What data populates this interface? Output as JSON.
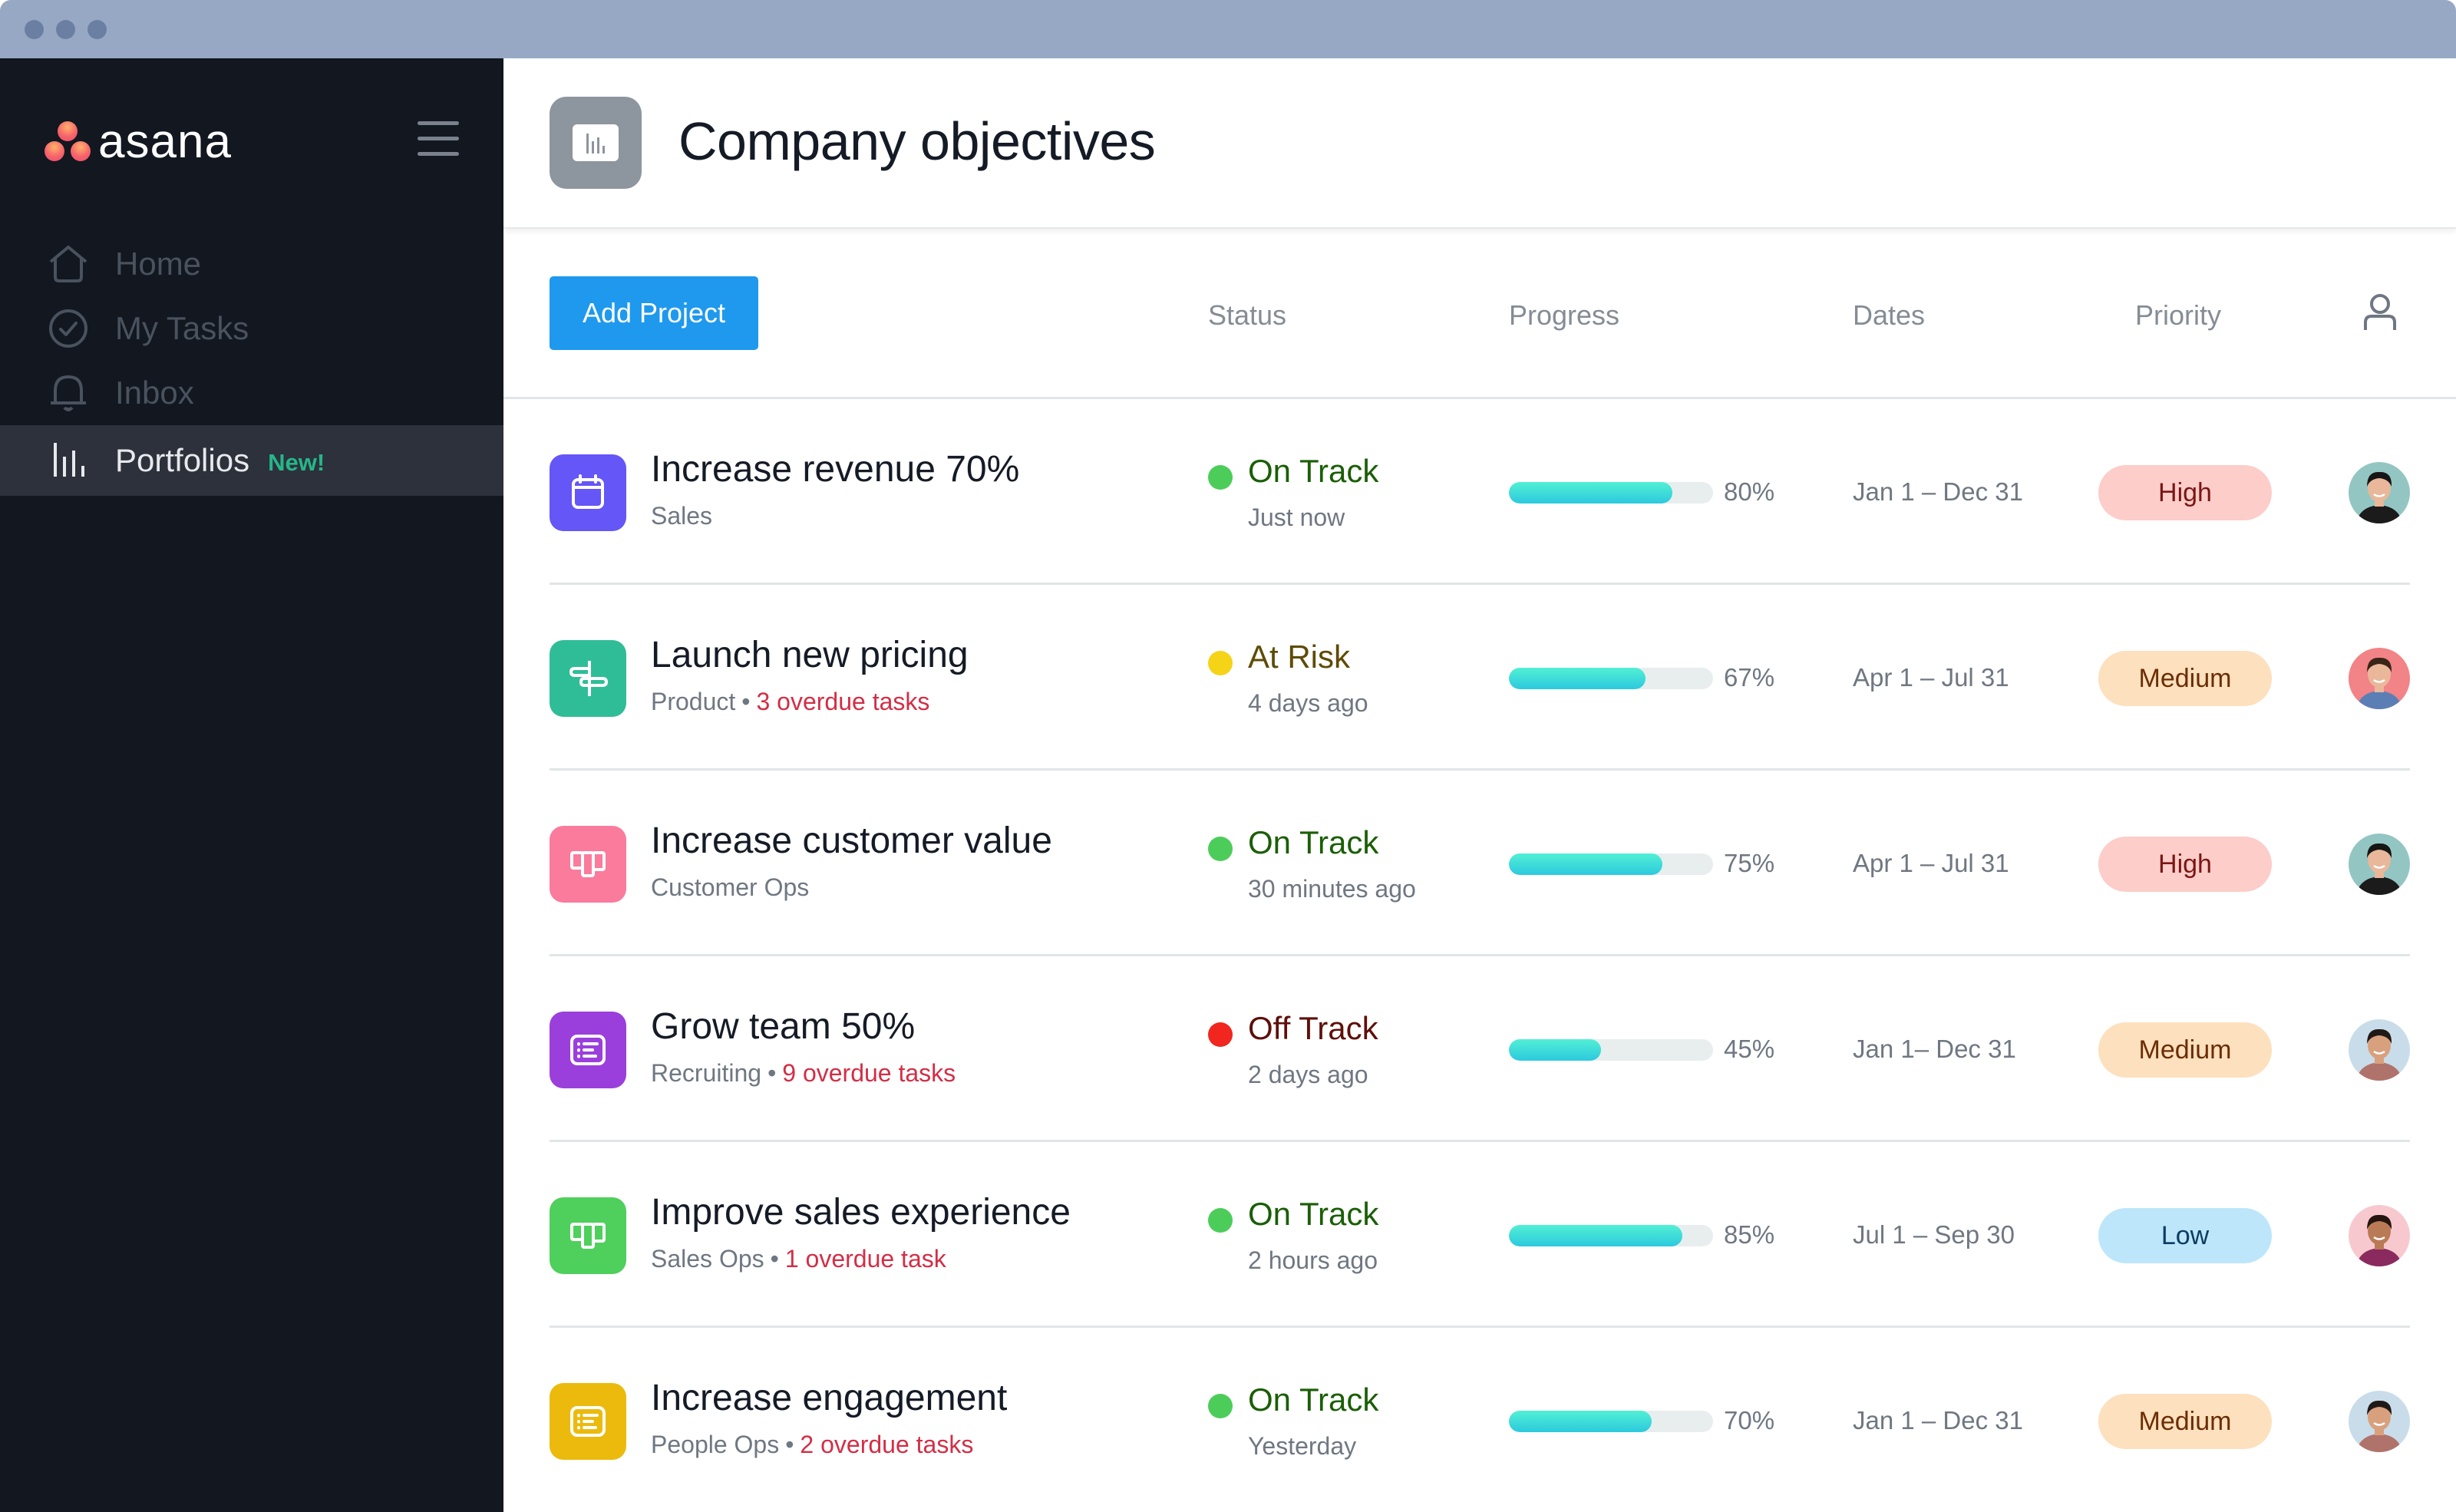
{
  "window": {
    "traffic_lights": [
      "close",
      "minimize",
      "maximize"
    ]
  },
  "sidebar": {
    "logo_text": "asana",
    "menu_icon": "hamburger-menu-icon",
    "items": [
      {
        "label": "Home",
        "icon": "home-icon",
        "active": false,
        "badge": null
      },
      {
        "label": "My Tasks",
        "icon": "check-circle-icon",
        "active": false,
        "badge": null
      },
      {
        "label": "Inbox",
        "icon": "bell-icon",
        "active": false,
        "badge": null
      },
      {
        "label": "Portfolios",
        "icon": "bar-chart-icon",
        "active": true,
        "badge": "New!"
      }
    ]
  },
  "header": {
    "icon": "portfolio-chart-icon",
    "title": "Company objectives"
  },
  "toolbar": {
    "add_project_label": "Add Project",
    "columns": [
      "Status",
      "Progress",
      "Dates",
      "Priority"
    ],
    "owner_icon": "person-icon"
  },
  "colors": {
    "accent": "#1e99ee",
    "on_track": "#4ccd5a",
    "at_risk": "#f5d317",
    "off_track": "#f0261f",
    "overdue": "#d32e46",
    "progress_fill": "#36d6db"
  },
  "projects": [
    {
      "name": "Increase revenue 70%",
      "team": "Sales",
      "overdue": null,
      "icon": "calendar-icon",
      "icon_color": "#6456f7",
      "status": "On Track",
      "status_color": "#4ccd5a",
      "status_text_color": "#1b5e06",
      "updated": "Just now",
      "progress": 80,
      "progress_label": "80%",
      "dates": "Jan 1 – Dec 31",
      "priority": "High",
      "priority_bg": "#fccdc9",
      "priority_fg": "#7a1614",
      "avatar": "avatar-woman-teal"
    },
    {
      "name": "Launch new pricing",
      "team": "Product",
      "overdue": "3 overdue tasks",
      "icon": "signpost-icon",
      "icon_color": "#2fbd98",
      "status": "At Risk",
      "status_color": "#f5d317",
      "status_text_color": "#5e4b05",
      "updated": "4 days ago",
      "progress": 67,
      "progress_label": "67%",
      "dates": "Apr 1 – Jul 31",
      "priority": "Medium",
      "priority_bg": "#fde0bd",
      "priority_fg": "#6b2d05",
      "avatar": "avatar-man-red"
    },
    {
      "name": "Increase customer value",
      "team": "Customer Ops",
      "overdue": null,
      "icon": "board-icon",
      "icon_color": "#fa7b9c",
      "status": "On Track",
      "status_color": "#4ccd5a",
      "status_text_color": "#1b5e06",
      "updated": "30 minutes ago",
      "progress": 75,
      "progress_label": "75%",
      "dates": "Apr 1 – Jul 31",
      "priority": "High",
      "priority_bg": "#fccdc9",
      "priority_fg": "#7a1614",
      "avatar": "avatar-woman-teal"
    },
    {
      "name": "Grow team 50%",
      "team": "Recruiting",
      "overdue": "9 overdue tasks",
      "icon": "list-icon",
      "icon_color": "#9a3fdc",
      "status": "Off Track",
      "status_color": "#f0261f",
      "status_text_color": "#5e0f0a",
      "updated": "2 days ago",
      "progress": 45,
      "progress_label": "45%",
      "dates": "Jan 1– Dec 31",
      "priority": "Medium",
      "priority_bg": "#fde0bd",
      "priority_fg": "#6b2d05",
      "avatar": "avatar-man-glasses"
    },
    {
      "name": "Improve sales experience",
      "team": "Sales Ops",
      "overdue": "1 overdue task",
      "icon": "board-icon",
      "icon_color": "#4fcf5c",
      "status": "On Track",
      "status_color": "#4ccd5a",
      "status_text_color": "#1b5e06",
      "updated": "2 hours ago",
      "progress": 85,
      "progress_label": "85%",
      "dates": "Jul 1 – Sep 30",
      "priority": "Low",
      "priority_bg": "#bde6fb",
      "priority_fg": "#0d3c61",
      "avatar": "avatar-woman-pink"
    },
    {
      "name": "Increase engagement",
      "team": "People Ops",
      "overdue": "2 overdue tasks",
      "icon": "list-icon",
      "icon_color": "#ebba0c",
      "status": "On Track",
      "status_color": "#4ccd5a",
      "status_text_color": "#1b5e06",
      "updated": "Yesterday",
      "progress": 70,
      "progress_label": "70%",
      "dates": "Jan 1 – Dec 31",
      "priority": "Medium",
      "priority_bg": "#fde0bd",
      "priority_fg": "#6b2d05",
      "avatar": "avatar-man-glasses"
    }
  ]
}
